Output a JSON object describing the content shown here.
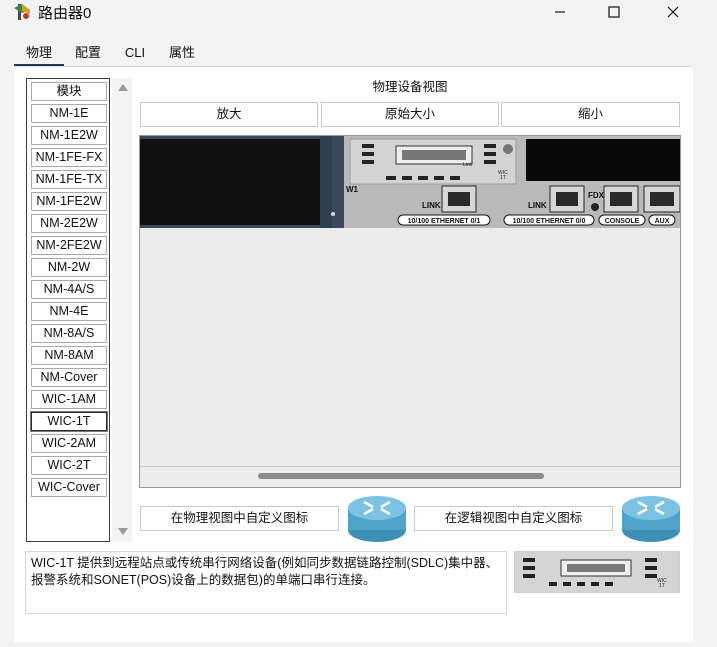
{
  "window": {
    "title": "路由器0",
    "minimize_icon": "minimize-icon",
    "maximize_icon": "maximize-icon",
    "close_icon": "close-icon"
  },
  "tabs": [
    {
      "label": "物理",
      "active": true
    },
    {
      "label": "配置",
      "active": false
    },
    {
      "label": "CLI",
      "active": false
    },
    {
      "label": "属性",
      "active": false
    }
  ],
  "modules": {
    "header": "模块",
    "items": [
      "NM-1E",
      "NM-1E2W",
      "NM-1FE-FX",
      "NM-1FE-TX",
      "NM-1FE2W",
      "NM-2E2W",
      "NM-2FE2W",
      "NM-2W",
      "NM-4A/S",
      "NM-4E",
      "NM-8A/S",
      "NM-8AM",
      "NM-Cover",
      "WIC-1AM",
      "WIC-1T",
      "WIC-2AM",
      "WIC-2T",
      "WIC-Cover"
    ],
    "selected": "WIC-1T"
  },
  "physical_view": {
    "title": "物理设备视图",
    "zoom_in": "放大",
    "original_size": "原始大小",
    "zoom_out": "缩小"
  },
  "device": {
    "slot_label": "W1",
    "wic_card_label": "WIC\n1T",
    "link_label_small": "Link",
    "link_label_1": "LINK",
    "link_label_2": "LINK",
    "fdx_label": "FDX",
    "port_1": "10/100 ETHERNET 0/1",
    "port_0": "10/100 ETHERNET 0/0",
    "console": "CONSOLE",
    "aux": "AUX"
  },
  "custom_icons": {
    "physical": "在物理视图中自定义图标",
    "logical": "在逻辑视图中自定义图标"
  },
  "description": "WIC-1T 提供到远程站点或传统串行网络设备(例如同步数据链路控制(SDLC)集中器、报警系统和SONET(POS)设备上的数据包)的单端口串行连接。",
  "colors": {
    "tab_underline": "#1e3a5f",
    "router_blue": "#4fa3c9",
    "device_chassis": "#b9b9b9"
  }
}
